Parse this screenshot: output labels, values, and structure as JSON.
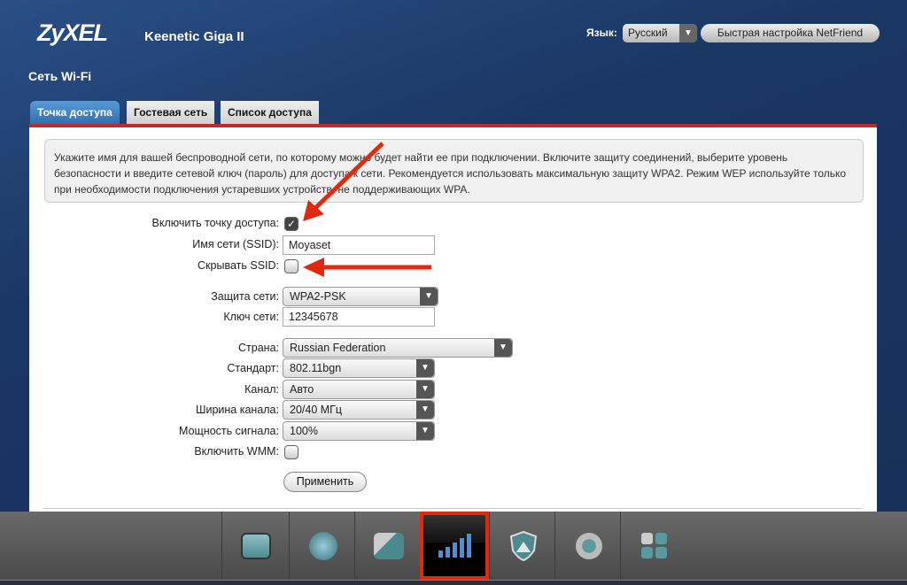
{
  "header": {
    "logo": "ZyXEL",
    "model": "Keenetic Giga II",
    "language_label": "Язык:",
    "language_value": "Русский",
    "netfriend_button": "Быстрая настройка NetFriend"
  },
  "page_title": "Сеть Wi-Fi",
  "tabs": [
    {
      "label": "Точка доступа",
      "active": true
    },
    {
      "label": "Гостевая сеть",
      "active": false
    },
    {
      "label": "Список доступа",
      "active": false
    }
  ],
  "info_text": "Укажите имя для вашей беспроводной сети, по которому можно будет найти ее при подключении. Включите защиту соединений, выберите уровень безопасности и введите сетевой ключ (пароль) для доступа к сети. Рекомендуется использовать максимальную защиту WPA2. Режим WEP используйте только при необходимости подключения устаревших устройств, не поддерживающих WPA.",
  "form": {
    "enable_ap": {
      "label": "Включить точку доступа:",
      "checked": true
    },
    "ssid": {
      "label": "Имя сети (SSID):",
      "value": "Moyaset"
    },
    "hide_ssid": {
      "label": "Скрывать SSID:",
      "checked": false
    },
    "security": {
      "label": "Защита сети:",
      "value": "WPA2-PSK"
    },
    "key": {
      "label": "Ключ сети:",
      "value": "12345678"
    },
    "country": {
      "label": "Страна:",
      "value": "Russian Federation"
    },
    "standard": {
      "label": "Стандарт:",
      "value": "802.11bgn"
    },
    "channel": {
      "label": "Канал:",
      "value": "Авто"
    },
    "width": {
      "label": "Ширина канала:",
      "value": "20/40 МГц"
    },
    "power": {
      "label": "Мощность сигнала:",
      "value": "100%"
    },
    "wmm": {
      "label": "Включить WMM:",
      "checked": false
    },
    "apply": "Применить"
  },
  "footer_nav": [
    {
      "icon": "monitor-chart-icon"
    },
    {
      "icon": "globe-icon"
    },
    {
      "icon": "network-computers-icon"
    },
    {
      "icon": "wifi-signal-icon",
      "active": true
    },
    {
      "icon": "shield-icon"
    },
    {
      "icon": "gear-icon"
    },
    {
      "icon": "apps-grid-icon"
    }
  ],
  "colors": {
    "annotation": "#e02a10",
    "tab_active": "#3b7fc0",
    "background": "#1a3663"
  }
}
